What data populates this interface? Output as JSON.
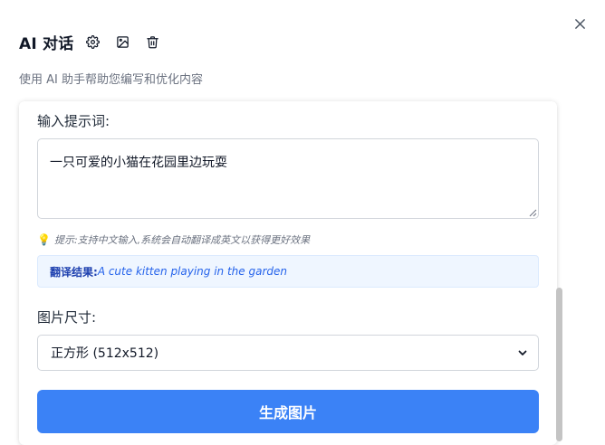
{
  "dialog": {
    "title": "AI 对话",
    "subtitle": "使用 AI 助手帮助您编写和优化内容",
    "toolbar_icons": [
      "gear-icon",
      "image-icon",
      "trash-icon"
    ],
    "close_icon": "close-icon"
  },
  "form": {
    "prompt_label": "输入提示词:",
    "prompt_value": "一只可爱的小猫在花园里边玩耍",
    "hint_icon": "lightbulb-icon",
    "hint_text": "提示:支持中文输入,系统会自动翻译成英文以获得更好效果",
    "translation_label": "翻译结果:",
    "translation_value": "A cute kitten playing in the garden",
    "size_label": "图片尺寸:",
    "size_selected": "正方形 (512x512)",
    "generate_button": "生成图片"
  },
  "colors": {
    "primary": "#3b82f6",
    "translation_bg": "#eff6ff",
    "translation_text": "#2563eb",
    "muted_text": "#6b7280"
  }
}
